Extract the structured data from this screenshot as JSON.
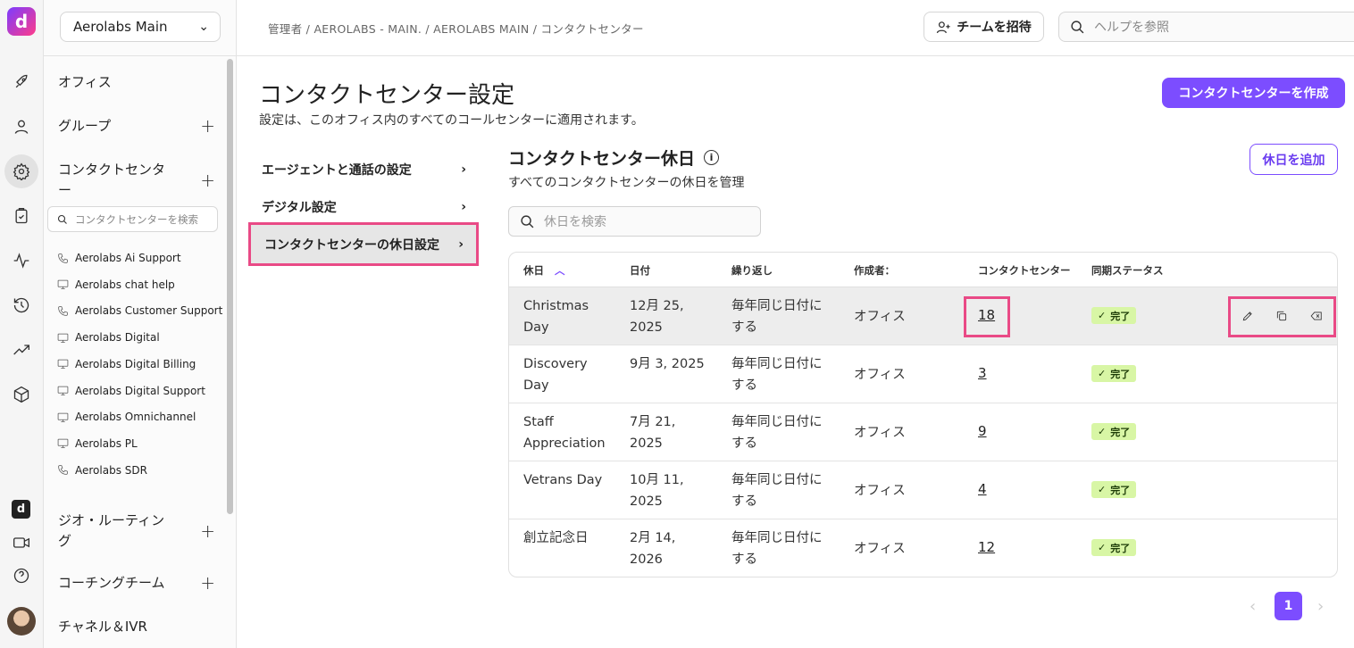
{
  "rail": {
    "logo": "d",
    "brand": "d",
    "icons": [
      "rocket-icon",
      "user-icon",
      "gear-icon",
      "clipboard-icon",
      "activity-icon",
      "history-icon",
      "trend-icon",
      "box-icon"
    ]
  },
  "sidebar": {
    "org": "Aerolabs Main",
    "sections": {
      "office": "オフィス",
      "groups": "グループ",
      "contact_centers": "コンタクトセンター",
      "geo_routing": "ジオ・ルーティング",
      "coaching": "コーチングチーム",
      "channels": "チャネル＆IVR"
    },
    "cc_search_placeholder": "コンタクトセンターを検索",
    "cc_items": [
      {
        "label": "Aerolabs Ai Support",
        "icon": "phone-icon"
      },
      {
        "label": "Aerolabs chat help",
        "icon": "monitor-icon"
      },
      {
        "label": "Aerolabs Customer Support",
        "icon": "phone-icon"
      },
      {
        "label": "Aerolabs Digital",
        "icon": "monitor-icon"
      },
      {
        "label": "Aerolabs Digital Billing",
        "icon": "monitor-icon"
      },
      {
        "label": "Aerolabs Digital Support",
        "icon": "monitor-icon"
      },
      {
        "label": "Aerolabs Omnichannel",
        "icon": "monitor-icon"
      },
      {
        "label": "Aerolabs PL",
        "icon": "monitor-icon"
      },
      {
        "label": "Aerolabs SDR",
        "icon": "phone-icon"
      }
    ]
  },
  "topbar": {
    "breadcrumb": "管理者 / AEROLABS - MAIN. / AEROLABS MAIN / コンタクトセンター",
    "invite_label": "チームを招待",
    "help_placeholder": "ヘルプを参照"
  },
  "page": {
    "title": "コンタクトセンター設定",
    "subtitle": "設定は、このオフィス内のすべてのコールセンターに適用されます。",
    "create_button": "コンタクトセンターを作成"
  },
  "subnav": [
    {
      "label": "エージェントと通話の設定"
    },
    {
      "label": "デジタル設定"
    },
    {
      "label": "コンタクトセンターの休日設定"
    }
  ],
  "holidays": {
    "title": "コンタクトセンター休日",
    "subtitle": "すべてのコンタクトセンターの休日を管理",
    "add_button": "休日を追加",
    "search_placeholder": "休日を検索",
    "columns": [
      "休日",
      "日付",
      "繰り返し",
      "作成者：",
      "コンタクトセンター",
      "同期ステータス"
    ],
    "rows": [
      {
        "name_l1": "Christmas",
        "name_l2": "Day",
        "date_l1": "12月 25,",
        "date_l2": "2025",
        "repeat_l1": "毎年同じ日付に",
        "repeat_l2": "する",
        "creator": "オフィス",
        "count": "18",
        "status": "完了"
      },
      {
        "name_l1": "Discovery",
        "name_l2": "Day",
        "date_l1": "9月 3, 2025",
        "date_l2": "",
        "repeat_l1": "毎年同じ日付に",
        "repeat_l2": "する",
        "creator": "オフィス",
        "count": "3",
        "status": "完了"
      },
      {
        "name_l1": "Staff",
        "name_l2": "Appreciation",
        "date_l1": "7月 21,",
        "date_l2": "2025",
        "repeat_l1": "毎年同じ日付に",
        "repeat_l2": "する",
        "creator": "オフィス",
        "count": "9",
        "status": "完了"
      },
      {
        "name_l1": "Vetrans Day",
        "name_l2": "",
        "date_l1": "10月 11,",
        "date_l2": "2025",
        "repeat_l1": "毎年同じ日付に",
        "repeat_l2": "する",
        "creator": "オフィス",
        "count": "4",
        "status": "完了"
      },
      {
        "name_l1": "創立記念日",
        "name_l2": "",
        "date_l1": "2月 14,",
        "date_l2": "2026",
        "repeat_l1": "毎年同じ日付に",
        "repeat_l2": "する",
        "creator": "オフィス",
        "count": "12",
        "status": "完了"
      }
    ]
  },
  "pagination": {
    "current": "1",
    "prev": "‹",
    "next": "›"
  },
  "colors": {
    "accent": "#7c4dff",
    "highlight": "#e94a86",
    "badge_bg": "#d8f6a5"
  }
}
